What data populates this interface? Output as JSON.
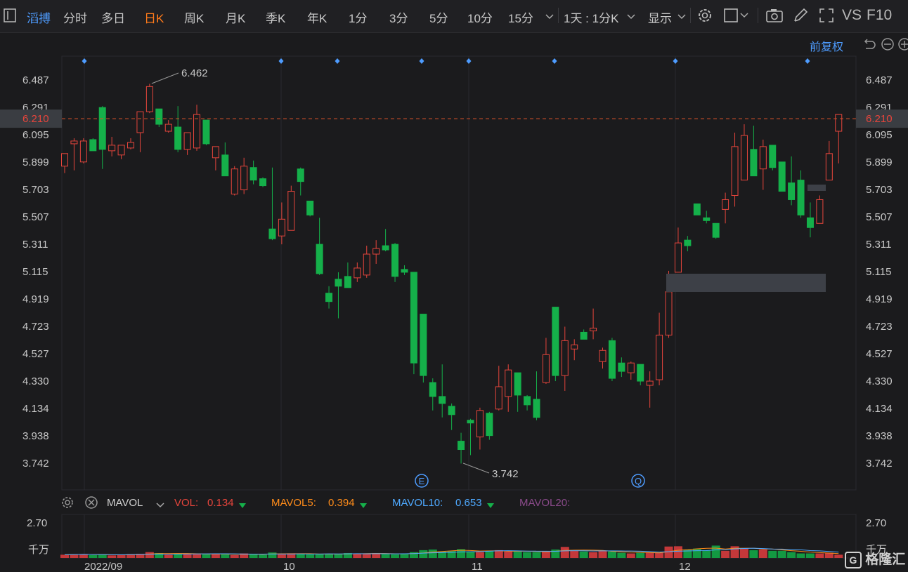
{
  "toolbar": {
    "stock_name": "滔搏",
    "periods": [
      "分时",
      "多日",
      "日K",
      "周K",
      "月K",
      "季K",
      "年K",
      "1分",
      "3分",
      "5分",
      "10分",
      "15分"
    ],
    "active_period": "日K",
    "interval_select": "1天 : 1分K",
    "display_label": "显示",
    "vs_label": "VS",
    "f10_label": "F10"
  },
  "adjust_label": "前复权",
  "colors": {
    "up": "#e6453c",
    "down": "#15b04a",
    "accent": "#ff7a1a",
    "link": "#4e9cff",
    "background": "#1b1b1d",
    "grid": "#2a2a2e",
    "price_line": "#e0532a"
  },
  "icons": [
    "gear-icon",
    "square-icon",
    "camera-icon",
    "pencil-icon",
    "expand-icon",
    "undo-icon",
    "minus-icon",
    "plus-icon",
    "settings-icon",
    "close-icon"
  ],
  "chart_data": {
    "type": "candlestick",
    "y_ticks": [
      "6.487",
      "6.291",
      "6.095",
      "5.899",
      "5.703",
      "5.507",
      "5.311",
      "5.115",
      "4.919",
      "4.723",
      "4.527",
      "4.330",
      "4.134",
      "3.938",
      "3.742"
    ],
    "ylim": [
      3.742,
      6.487
    ],
    "current_price": "6.210",
    "annotations": {
      "high": "6.462",
      "low": "3.742"
    },
    "event_markers": [
      "E",
      "Q"
    ],
    "x_labels": [
      "2022/09",
      "10",
      "11",
      "12"
    ],
    "candles": [
      {
        "o": 5.87,
        "h": 5.93,
        "l": 5.82,
        "c": 5.96
      },
      {
        "o": 6.03,
        "h": 6.07,
        "l": 5.84,
        "c": 6.05
      },
      {
        "o": 5.9,
        "h": 6.07,
        "l": 5.89,
        "c": 6.05
      },
      {
        "o": 6.06,
        "h": 6.07,
        "l": 5.99,
        "c": 5.98
      },
      {
        "o": 6.29,
        "h": 6.3,
        "l": 5.85,
        "c": 5.99
      },
      {
        "o": 5.98,
        "h": 6.08,
        "l": 5.94,
        "c": 6.02
      },
      {
        "o": 5.95,
        "h": 6.02,
        "l": 5.92,
        "c": 6.02
      },
      {
        "o": 6.0,
        "h": 6.07,
        "l": 5.99,
        "c": 6.04
      },
      {
        "o": 6.11,
        "h": 6.26,
        "l": 5.97,
        "c": 6.26
      },
      {
        "o": 6.26,
        "h": 6.46,
        "l": 6.25,
        "c": 6.44
      },
      {
        "o": 6.28,
        "h": 6.28,
        "l": 6.15,
        "c": 6.17
      },
      {
        "o": 6.12,
        "h": 6.2,
        "l": 6.11,
        "c": 6.17
      },
      {
        "o": 6.15,
        "h": 6.3,
        "l": 5.97,
        "c": 5.99
      },
      {
        "o": 5.99,
        "h": 6.03,
        "l": 5.95,
        "c": 6.11
      },
      {
        "o": 6.0,
        "h": 6.31,
        "l": 5.98,
        "c": 6.24
      },
      {
        "o": 6.2,
        "h": 6.2,
        "l": 6.02,
        "c": 6.03
      },
      {
        "o": 5.93,
        "h": 6.01,
        "l": 5.84,
        "c": 6.01
      },
      {
        "o": 5.95,
        "h": 6.04,
        "l": 5.8,
        "c": 5.8
      },
      {
        "o": 5.67,
        "h": 5.87,
        "l": 5.66,
        "c": 5.85
      },
      {
        "o": 5.7,
        "h": 5.93,
        "l": 5.67,
        "c": 5.87
      },
      {
        "o": 5.86,
        "h": 5.91,
        "l": 5.74,
        "c": 5.77
      },
      {
        "o": 5.78,
        "h": 5.79,
        "l": 5.72,
        "c": 5.73
      },
      {
        "o": 5.42,
        "h": 5.86,
        "l": 5.34,
        "c": 5.35
      },
      {
        "o": 5.37,
        "h": 5.61,
        "l": 5.31,
        "c": 5.49
      },
      {
        "o": 5.41,
        "h": 5.73,
        "l": 5.41,
        "c": 5.69
      },
      {
        "o": 5.85,
        "h": 5.86,
        "l": 5.66,
        "c": 5.76
      },
      {
        "o": 5.62,
        "h": 5.62,
        "l": 5.51,
        "c": 5.52
      },
      {
        "o": 5.31,
        "h": 5.5,
        "l": 5.09,
        "c": 5.1
      },
      {
        "o": 4.96,
        "h": 5.01,
        "l": 4.85,
        "c": 4.9
      },
      {
        "o": 5.06,
        "h": 5.11,
        "l": 4.78,
        "c": 5.01
      },
      {
        "o": 5.08,
        "h": 5.18,
        "l": 5.0,
        "c": 5.0
      },
      {
        "o": 5.07,
        "h": 5.18,
        "l": 5.04,
        "c": 5.14
      },
      {
        "o": 5.09,
        "h": 5.3,
        "l": 5.07,
        "c": 5.24
      },
      {
        "o": 5.24,
        "h": 5.34,
        "l": 5.17,
        "c": 5.28
      },
      {
        "o": 5.3,
        "h": 5.42,
        "l": 5.26,
        "c": 5.27
      },
      {
        "o": 5.31,
        "h": 5.32,
        "l": 5.04,
        "c": 5.08
      },
      {
        "o": 5.13,
        "h": 5.16,
        "l": 5.09,
        "c": 5.11
      },
      {
        "o": 5.11,
        "h": 5.11,
        "l": 4.38,
        "c": 4.46
      },
      {
        "o": 4.81,
        "h": 4.81,
        "l": 4.32,
        "c": 4.37
      },
      {
        "o": 4.32,
        "h": 4.35,
        "l": 4.12,
        "c": 4.22
      },
      {
        "o": 4.22,
        "h": 4.45,
        "l": 4.07,
        "c": 4.17
      },
      {
        "o": 4.15,
        "h": 4.17,
        "l": 3.98,
        "c": 4.09
      },
      {
        "o": 3.9,
        "h": 3.96,
        "l": 3.74,
        "c": 3.84
      },
      {
        "o": 4.05,
        "h": 4.06,
        "l": 3.8,
        "c": 4.03
      },
      {
        "o": 3.93,
        "h": 4.14,
        "l": 3.84,
        "c": 4.12
      },
      {
        "o": 4.1,
        "h": 4.11,
        "l": 3.91,
        "c": 3.94
      },
      {
        "o": 4.13,
        "h": 4.44,
        "l": 4.12,
        "c": 4.29
      },
      {
        "o": 4.22,
        "h": 4.45,
        "l": 4.11,
        "c": 4.41
      },
      {
        "o": 4.39,
        "h": 4.39,
        "l": 4.11,
        "c": 4.23
      },
      {
        "o": 4.22,
        "h": 4.23,
        "l": 4.12,
        "c": 4.16
      },
      {
        "o": 4.2,
        "h": 4.4,
        "l": 4.05,
        "c": 4.07
      },
      {
        "o": 4.32,
        "h": 4.64,
        "l": 4.31,
        "c": 4.52
      },
      {
        "o": 4.86,
        "h": 4.86,
        "l": 4.33,
        "c": 4.37
      },
      {
        "o": 4.37,
        "h": 4.72,
        "l": 4.26,
        "c": 4.62
      },
      {
        "o": 4.56,
        "h": 4.63,
        "l": 4.48,
        "c": 4.59
      },
      {
        "o": 4.68,
        "h": 4.7,
        "l": 4.63,
        "c": 4.63
      },
      {
        "o": 4.69,
        "h": 4.85,
        "l": 4.63,
        "c": 4.71
      },
      {
        "o": 4.47,
        "h": 4.57,
        "l": 4.42,
        "c": 4.55
      },
      {
        "o": 4.62,
        "h": 4.64,
        "l": 4.33,
        "c": 4.35
      },
      {
        "o": 4.46,
        "h": 4.5,
        "l": 4.36,
        "c": 4.4
      },
      {
        "o": 4.39,
        "h": 4.47,
        "l": 4.34,
        "c": 4.46
      },
      {
        "o": 4.45,
        "h": 4.45,
        "l": 4.3,
        "c": 4.33
      },
      {
        "o": 4.3,
        "h": 4.4,
        "l": 4.14,
        "c": 4.33
      },
      {
        "o": 4.34,
        "h": 4.82,
        "l": 4.3,
        "c": 4.66
      },
      {
        "o": 4.66,
        "h": 5.12,
        "l": 4.64,
        "c": 4.97
      },
      {
        "o": 5.11,
        "h": 5.43,
        "l": 5.11,
        "c": 5.32
      },
      {
        "o": 5.34,
        "h": 5.37,
        "l": 5.26,
        "c": 5.3
      },
      {
        "o": 5.6,
        "h": 5.6,
        "l": 5.52,
        "c": 5.52
      },
      {
        "o": 5.5,
        "h": 5.55,
        "l": 5.46,
        "c": 5.48
      },
      {
        "o": 5.46,
        "h": 5.46,
        "l": 5.35,
        "c": 5.36
      },
      {
        "o": 5.56,
        "h": 5.68,
        "l": 5.46,
        "c": 5.63
      },
      {
        "o": 5.66,
        "h": 6.11,
        "l": 5.58,
        "c": 6.01
      },
      {
        "o": 5.77,
        "h": 6.17,
        "l": 5.77,
        "c": 6.09
      },
      {
        "o": 5.99,
        "h": 6.16,
        "l": 5.85,
        "c": 5.8
      },
      {
        "o": 5.85,
        "h": 6.06,
        "l": 5.7,
        "c": 6.01
      },
      {
        "o": 6.02,
        "h": 6.02,
        "l": 5.84,
        "c": 5.86
      },
      {
        "o": 5.9,
        "h": 5.9,
        "l": 5.69,
        "c": 5.69
      },
      {
        "o": 5.75,
        "h": 5.94,
        "l": 5.59,
        "c": 5.63
      },
      {
        "o": 5.77,
        "h": 5.84,
        "l": 5.5,
        "c": 5.52
      },
      {
        "o": 5.5,
        "h": 5.61,
        "l": 5.36,
        "c": 5.43
      },
      {
        "o": 5.46,
        "h": 5.66,
        "l": 5.46,
        "c": 5.63
      },
      {
        "o": 5.77,
        "h": 6.05,
        "l": 5.77,
        "c": 5.96
      },
      {
        "o": 6.12,
        "h": 6.24,
        "l": 5.89,
        "c": 6.24
      }
    ],
    "volume": {
      "indicator": "MAVOL",
      "vol_label": "VOL:",
      "vol": "0.134",
      "mavol5_label": "MAVOL5:",
      "mavol5": "0.394",
      "mavol10_label": "MAVOL10:",
      "mavol10": "0.653",
      "mavol20_label": "MAVOL20:",
      "y_ticks": [
        "2.70"
      ],
      "unit": "千万",
      "values": [
        0.25,
        0.28,
        0.3,
        0.22,
        0.26,
        0.2,
        0.24,
        0.3,
        0.32,
        0.45,
        0.38,
        0.25,
        0.33,
        0.3,
        0.35,
        0.28,
        0.3,
        0.28,
        0.22,
        0.35,
        0.3,
        0.25,
        0.42,
        0.3,
        0.36,
        0.31,
        0.27,
        0.28,
        0.3,
        0.33,
        0.38,
        0.34,
        0.33,
        0.38,
        0.3,
        0.28,
        0.3,
        0.45,
        0.6,
        0.65,
        0.5,
        0.55,
        0.68,
        0.5,
        0.45,
        0.55,
        0.6,
        0.5,
        0.5,
        0.45,
        0.45,
        0.5,
        0.65,
        0.85,
        0.55,
        0.5,
        0.45,
        0.55,
        0.5,
        0.4,
        0.35,
        0.4,
        0.4,
        0.4,
        0.88,
        0.9,
        0.62,
        0.72,
        0.6,
        0.95,
        0.55,
        0.9,
        0.75,
        0.6,
        0.65,
        0.55,
        0.55,
        0.45,
        0.35,
        0.35,
        0.35,
        0.4,
        0.25
      ]
    }
  },
  "ma_lines": {
    "mavol5_color": "#ff8c1a",
    "mavol10_color": "#4ea9ff"
  },
  "watermark": "格隆汇"
}
